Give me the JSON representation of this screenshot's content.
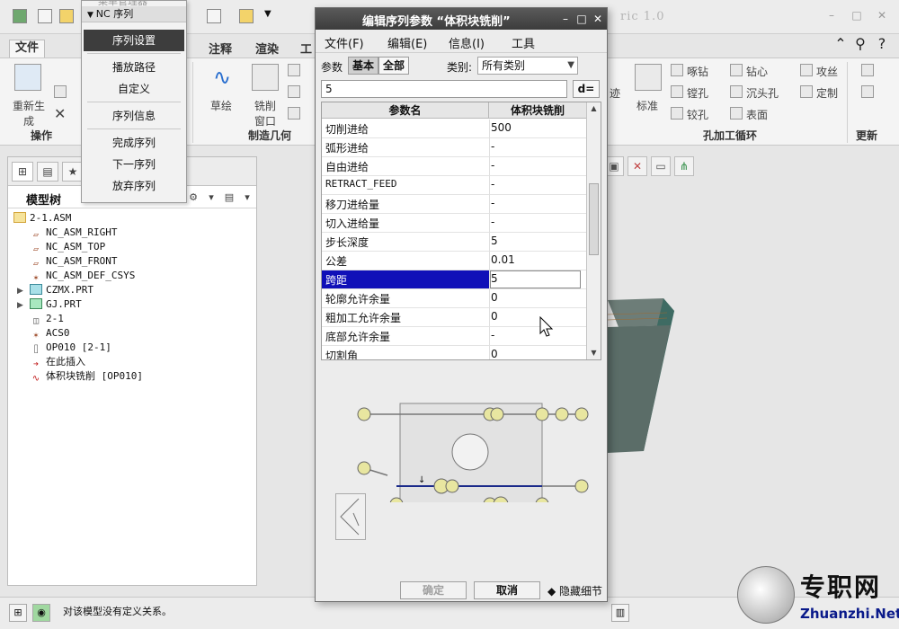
{
  "app": {
    "title_partial": "ric 1.0",
    "ribbon_tabs": {
      "file": "文件",
      "annotate": "注释",
      "render": "渲染",
      "tools_partial": "工"
    },
    "groups": {
      "operations": "操作",
      "manufacturing_geometry": "制造几何",
      "hole_cycles": "孔加工循环",
      "update": "更新"
    },
    "ribbon_buttons": {
      "regenerate": "重新生成",
      "sketch": "草绘",
      "mill_window": "铣削窗口",
      "trace": "迹",
      "standard": "标准",
      "spot_drill": "啄钻",
      "drill": "钻心",
      "tap": "攻丝",
      "bore": "镗孔",
      "countersink": "沉头孔",
      "custom": "定制",
      "ream": "铰孔",
      "face": "表面"
    }
  },
  "nc_menu": {
    "ghost_title": "菜单管理器",
    "header": "NC 序列",
    "items": {
      "seq_setup": "序列设置",
      "play_path": "播放路径",
      "customize": "自定义",
      "seq_info": "序列信息",
      "done_seq": "完成序列",
      "next_seq": "下一序列",
      "quit_seq": "放弃序列"
    }
  },
  "dialog": {
    "title": "编辑序列参数 “体积块铣削”",
    "menu": {
      "file": "文件(F)",
      "edit": "编辑(E)",
      "info": "信息(I)",
      "tools": "工具"
    },
    "filter": {
      "params_label": "参数",
      "basic": "基本",
      "all": "全部",
      "category_label": "类别:",
      "category_value": "所有类别"
    },
    "value_input": "5",
    "d_button": "d=",
    "table": {
      "col_name": "参数名",
      "col_value": "体积块铣削",
      "rows": [
        {
          "name": "切削进给",
          "value": "500"
        },
        {
          "name": "弧形进给",
          "value": "-"
        },
        {
          "name": "自由进给",
          "value": "-"
        },
        {
          "name": "RETRACT_FEED",
          "value": "-"
        },
        {
          "name": "移刀进给量",
          "value": "-"
        },
        {
          "name": "切入进给量",
          "value": "-"
        },
        {
          "name": "步长深度",
          "value": "5"
        },
        {
          "name": "公差",
          "value": "0.01"
        },
        {
          "name": "跨距",
          "value": "5"
        },
        {
          "name": "轮廓允许余量",
          "value": "0"
        },
        {
          "name": "粗加工允许余量",
          "value": "0"
        },
        {
          "name": "底部允许余量",
          "value": "-"
        },
        {
          "name": "切割角",
          "value": "0"
        }
      ]
    },
    "footer": {
      "ok": "确定",
      "cancel": "取消",
      "hide_details": "隐藏细节"
    }
  },
  "model_tree": {
    "title": "模型树",
    "nodes": [
      {
        "label": "2-1.ASM"
      },
      {
        "label": "NC_ASM_RIGHT"
      },
      {
        "label": "NC_ASM_TOP"
      },
      {
        "label": "NC_ASM_FRONT"
      },
      {
        "label": "NC_ASM_DEF_CSYS"
      },
      {
        "label": "CZMX.PRT"
      },
      {
        "label": "GJ.PRT"
      },
      {
        "label": "2-1"
      },
      {
        "label": "ACS0"
      },
      {
        "label": "OP010 [2-1]"
      },
      {
        "label": "在此插入"
      },
      {
        "label": "体积块铣削 [OP010]"
      }
    ]
  },
  "status": {
    "message": "对该模型没有定义关系。"
  },
  "watermark": {
    "cn": "专职网",
    "en": "Zhuanzhi.Net"
  },
  "colors": {
    "selection_blue": "#1010b8",
    "dialog_title": "#3c3c3c",
    "menu_active": "#3d3d3d",
    "part_teal": "#3e6b63",
    "diagram_blue": "#1a2a8a",
    "diagram_yellow": "#e8e6a0"
  }
}
